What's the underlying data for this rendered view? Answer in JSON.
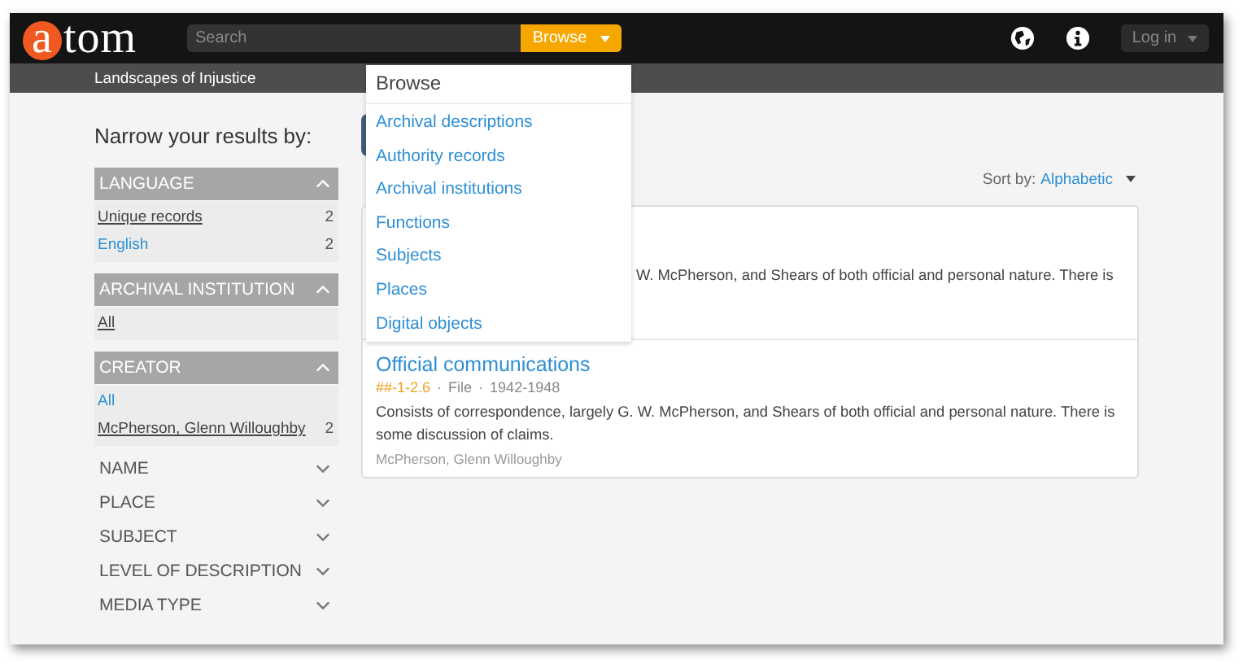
{
  "header": {
    "logo": "atom",
    "search": {
      "placeholder": "Search"
    },
    "browse_button": "Browse",
    "login_button": "Log in"
  },
  "subheader": {
    "repository": "Landscapes of Injustice"
  },
  "sidebar": {
    "title": "Narrow your results by:",
    "facets": [
      {
        "label": "LANGUAGE",
        "expanded": true,
        "items": [
          {
            "label": "Unique records",
            "count": "2",
            "selected": true
          },
          {
            "label": "English",
            "count": "2",
            "selected": false
          }
        ]
      },
      {
        "label": "ARCHIVAL INSTITUTION",
        "expanded": true,
        "items": [
          {
            "label": "All",
            "selected": true
          }
        ]
      },
      {
        "label": "CREATOR",
        "expanded": true,
        "items": [
          {
            "label": "All",
            "selected": false
          },
          {
            "label": "McPherson, Glenn Willoughby",
            "count": "2",
            "selected": true
          }
        ]
      },
      {
        "label": "NAME",
        "expanded": false
      },
      {
        "label": "PLACE",
        "expanded": false
      },
      {
        "label": "SUBJECT",
        "expanded": false
      },
      {
        "label": "LEVEL OF DESCRIPTION",
        "expanded": false
      },
      {
        "label": "MEDIA TYPE",
        "expanded": false
      }
    ]
  },
  "results": {
    "sort_label": "Sort by:",
    "sort_value": "Alphabetic",
    "items": [
      {
        "description": "W. McPherson, and Shears of both official and personal nature. There is"
      },
      {
        "title": "Official communications",
        "meta": [
          {
            "kind": "reference",
            "text": "##-1-2.6"
          },
          {
            "kind": "separator",
            "text": "·"
          },
          {
            "kind": "level",
            "text": "File"
          },
          {
            "kind": "separator",
            "text": "·"
          },
          {
            "kind": "dates",
            "text": "1942-1948"
          }
        ],
        "description": "Consists of correspondence, largely G. W. McPherson, and Shears of both official and personal nature. There is some discussion of claims.",
        "creator": "McPherson, Glenn Willoughby"
      }
    ]
  },
  "browse_menu": {
    "title": "Browse",
    "items": [
      "Archival descriptions",
      "Authority records",
      "Archival institutions",
      "Functions",
      "Subjects",
      "Places",
      "Digital objects"
    ]
  }
}
